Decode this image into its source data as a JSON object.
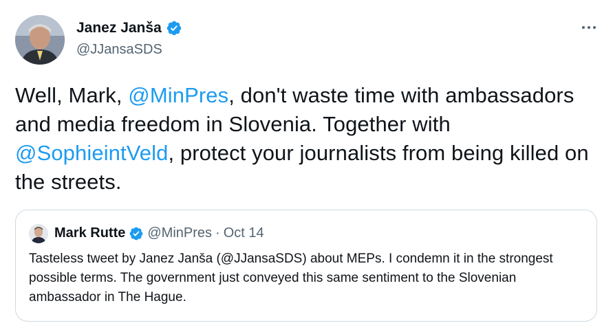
{
  "author": {
    "name": "Janez Janša",
    "handle": "@JJansaSDS"
  },
  "tweet_text": {
    "part1": "Well, Mark, ",
    "mention1": "@MinPres",
    "part2": ", don't waste time with ambassadors and media freedom in Slovenia.  Together with ",
    "mention2": "@SophieintVeld",
    "part3": ",  protect your journalists from being killed on the streets."
  },
  "quoted": {
    "name": "Mark Rutte",
    "handle": "@MinPres",
    "separator": "·",
    "date": "Oct 14",
    "text": "Tasteless tweet by Janez Janša (@JJansaSDS) about MEPs. I condemn it in the strongest possible terms. The government just conveyed this same sentiment to the Slovenian ambassador in The Hague."
  },
  "colors": {
    "link": "#1d9bf0",
    "verified": "#1d9bf0",
    "secondary_text": "#536471",
    "border": "#cfd9de"
  },
  "icons": [
    "verified-badge-icon",
    "more-options-icon"
  ]
}
